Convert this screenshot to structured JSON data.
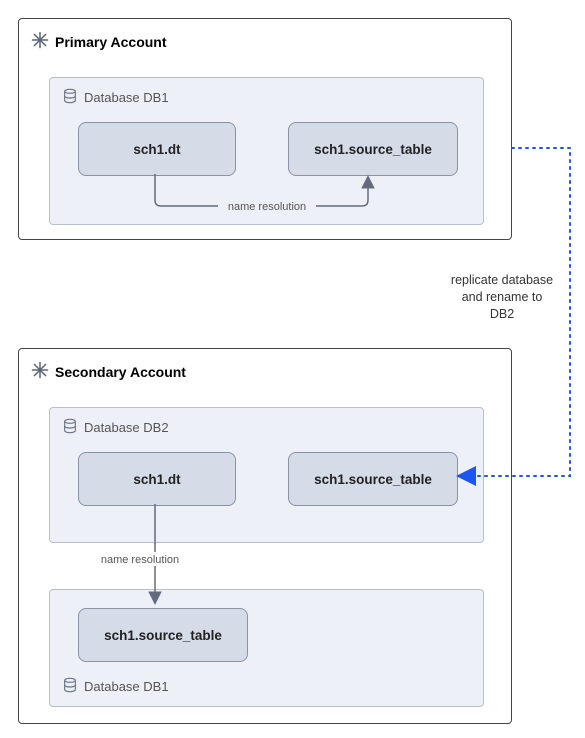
{
  "primary": {
    "title": "Primary Account",
    "database": {
      "title": "Database DB1",
      "entities": {
        "dt": "sch1.dt",
        "source": "sch1.source_table"
      },
      "resolution_label": "name resolution"
    }
  },
  "secondary": {
    "title": "Secondary Account",
    "db2": {
      "title": "Database DB2",
      "entities": {
        "dt": "sch1.dt",
        "source": "sch1.source_table"
      }
    },
    "db1": {
      "title": "Database DB1",
      "entities": {
        "source": "sch1.source_table"
      }
    },
    "resolution_label": "name resolution"
  },
  "replicate_label": "replicate database\nand rename to\nDB2"
}
